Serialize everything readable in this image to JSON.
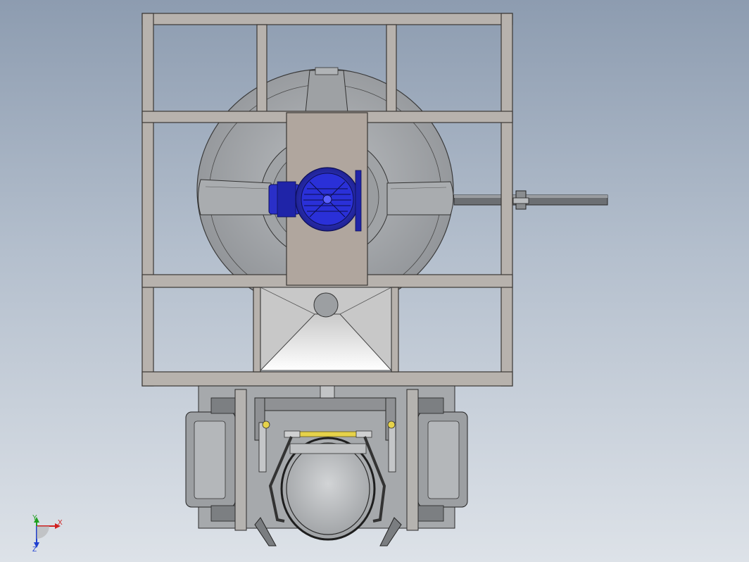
{
  "view": {
    "colors": {
      "background_top": "#8d9cb0",
      "background_bottom": "#dde2e8",
      "frame_steel": "#b7b2ad",
      "tank_body": "#a7aaad",
      "motor_blue": "#2a2fc8",
      "highlight_yellow": "#e6d24a"
    }
  },
  "triad": {
    "x_label": "X",
    "y_label": "Y",
    "z_label": "Z",
    "x_color": "#d02020",
    "y_color": "#20a020",
    "z_color": "#2040d0"
  }
}
